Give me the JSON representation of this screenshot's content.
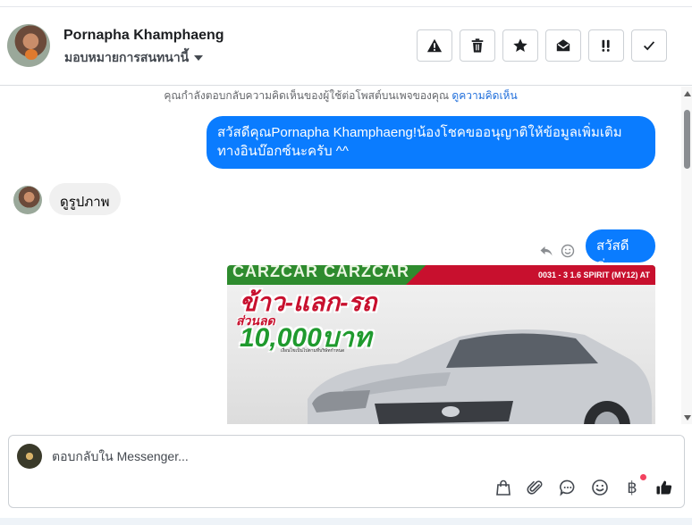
{
  "header": {
    "contact_name": "Pornapha Khamphaeng",
    "assign_label": "มอบหมายการสนทนานี้",
    "actions": [
      {
        "name": "spam-button",
        "icon": "warning-icon"
      },
      {
        "name": "delete-button",
        "icon": "trash-icon"
      },
      {
        "name": "star-button",
        "icon": "star-icon"
      },
      {
        "name": "mark-unread-button",
        "icon": "envelope-open-icon"
      },
      {
        "name": "follow-up-button",
        "icon": "double-exclamation-icon"
      },
      {
        "name": "mark-done-button",
        "icon": "check-icon"
      }
    ]
  },
  "chat": {
    "notice_text": "คุณกำลังตอบกลับความคิดเห็นของผู้ใช้ต่อโพสต์บนเพจของคุณ",
    "notice_link": "ดูความคิดเห็น",
    "messages": [
      {
        "direction": "outgoing",
        "text": "สวัสดีคุณPornapha Khamphaeng!น้องโชคขออนุญาติให้ข้อมูลเพิ่มเติม ทางอินบ๊อกซ์นะครับ ^^"
      },
      {
        "direction": "incoming",
        "text": "ดูรูปภาพ"
      },
      {
        "direction": "outgoing",
        "text": "สวัสดีค่ะ"
      }
    ],
    "ad_image": {
      "brand_text": "CARZCAR CARZCAR",
      "model_text": "0031 - 3 1.6 SPIRIT (MY12) AT",
      "headline": "ข้าว-แลก-รถ",
      "discount_label": "ส่วนลด",
      "discount_amount": "10,000บาท",
      "fine_print": "เงื่อนไขเป็นไปตามที่บริษัทกำหนด"
    }
  },
  "composer": {
    "placeholder": "ตอบกลับใน Messenger...",
    "tools": [
      "shopping-bag-icon",
      "paperclip-icon",
      "saved-reply-icon",
      "emoji-icon",
      "baht-icon",
      "thumbs-up-icon"
    ],
    "baht_symbol": "฿"
  },
  "colors": {
    "outgoing_bubble": "#0a7cff",
    "incoming_bubble": "#f0f0f0",
    "link": "#216fdb",
    "notification_dot": "#f3425f"
  }
}
